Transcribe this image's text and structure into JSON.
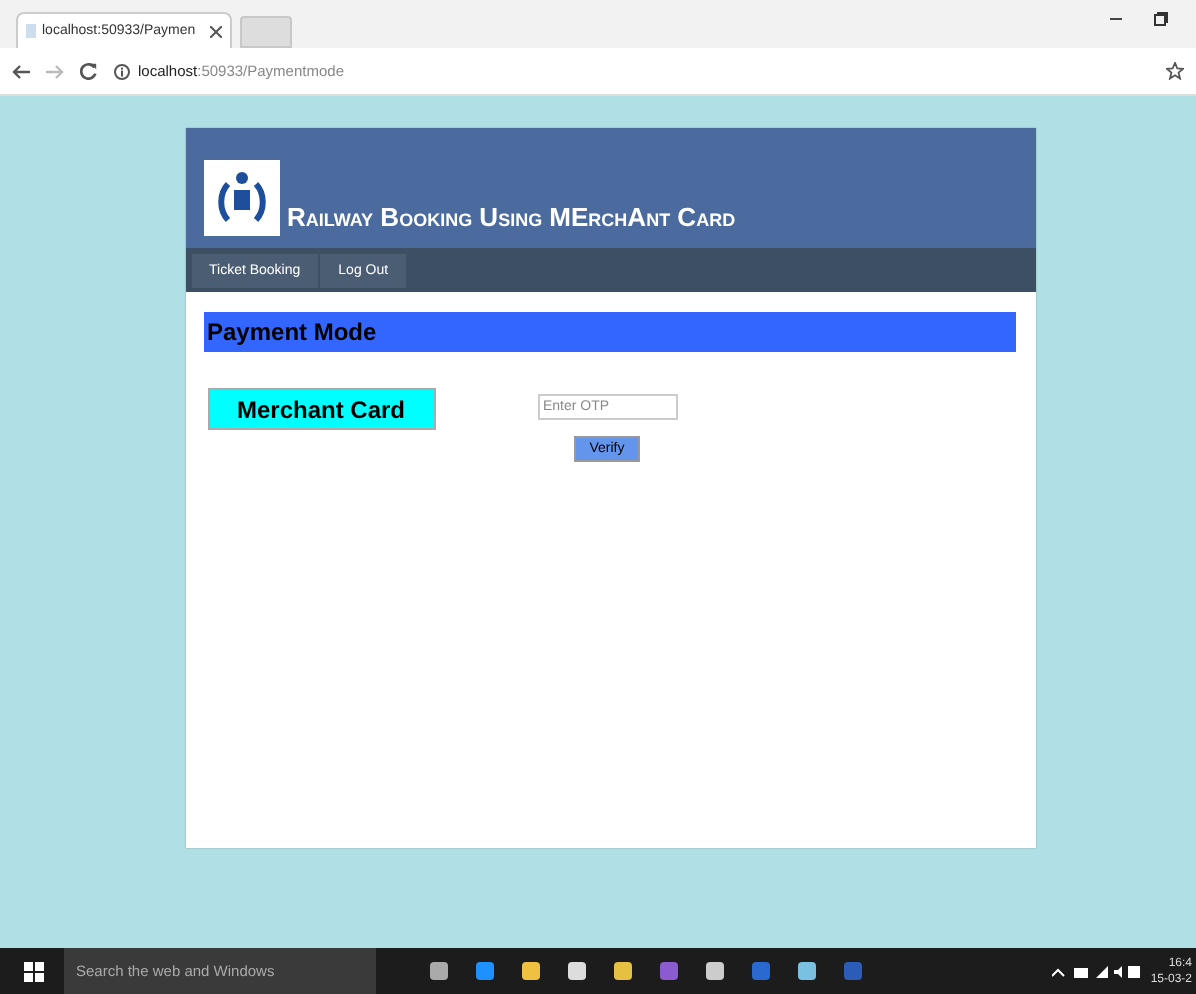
{
  "browser": {
    "tab_title": "localhost:50933/Paymen",
    "address_host": "localhost",
    "address_path": ":50933/Paymentmode"
  },
  "site": {
    "title": "Railway Booking Using MErchAnt Card",
    "nav": [
      {
        "label": "Ticket Booking"
      },
      {
        "label": "Log Out"
      }
    ],
    "section_heading": "Payment Mode",
    "method_button": "Merchant Card",
    "otp": {
      "placeholder": "Enter OTP"
    },
    "verify_button": "Verify"
  },
  "taskbar": {
    "search_placeholder": "Search the web and Windows",
    "time": "16:4",
    "date": "15-03-2"
  }
}
